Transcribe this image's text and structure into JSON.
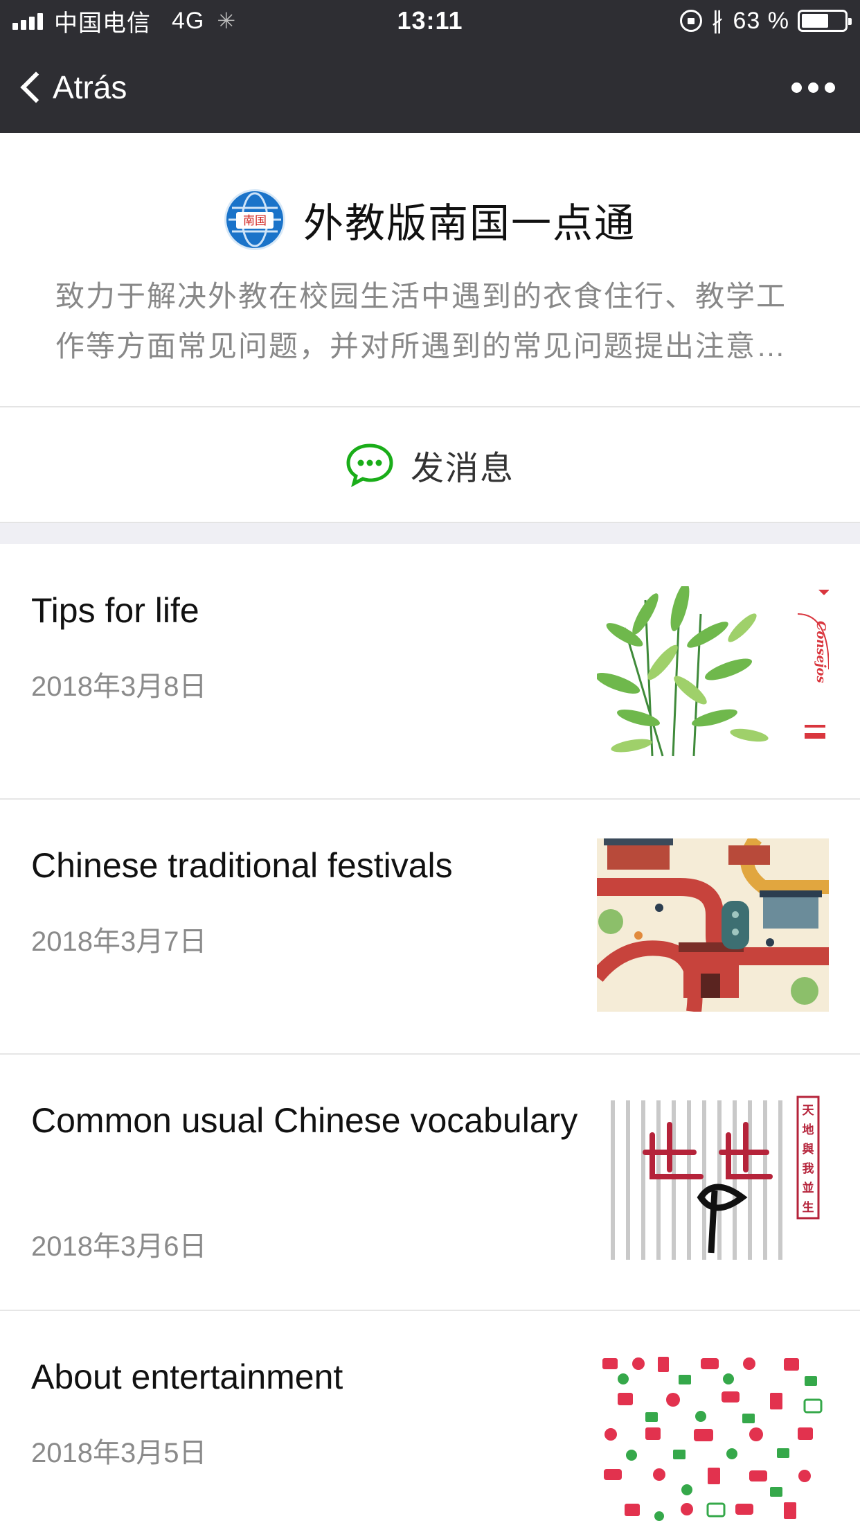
{
  "status_bar": {
    "carrier": "中国电信",
    "network": "4G",
    "time": "13:11",
    "battery": "63 %",
    "battery_level": 0.63
  },
  "nav": {
    "back_label": "Atrás"
  },
  "account": {
    "name": "外教版南国一点通",
    "logo_text": "南国",
    "description": "致力于解决外教在校园生活中遇到的衣食住行、教学工作等方面常见问题，并对所遇到的常见问题提出注意…"
  },
  "actions": {
    "send_message_label": "发消息"
  },
  "colors": {
    "nav_bg": "#2e2e33",
    "wechat_green": "#1aad19",
    "logo_blue": "#1a73c9"
  },
  "articles": [
    {
      "title": "Tips for life",
      "date": "2018年3月8日",
      "thumb_text": "Consejos",
      "thumb": "bamboo-illustration"
    },
    {
      "title": "Chinese traditional festivals",
      "date": "2018年3月7日",
      "thumb": "festival-map-illustration"
    },
    {
      "title": "Common usual Chinese vocabulary",
      "date": "2018年3月6日",
      "thumb_text": "天地與我並生",
      "thumb": "calligraphy-illustration"
    },
    {
      "title": "About entertainment",
      "date": "2018年3月5日",
      "thumb": "entertainment-icons-pattern"
    }
  ]
}
